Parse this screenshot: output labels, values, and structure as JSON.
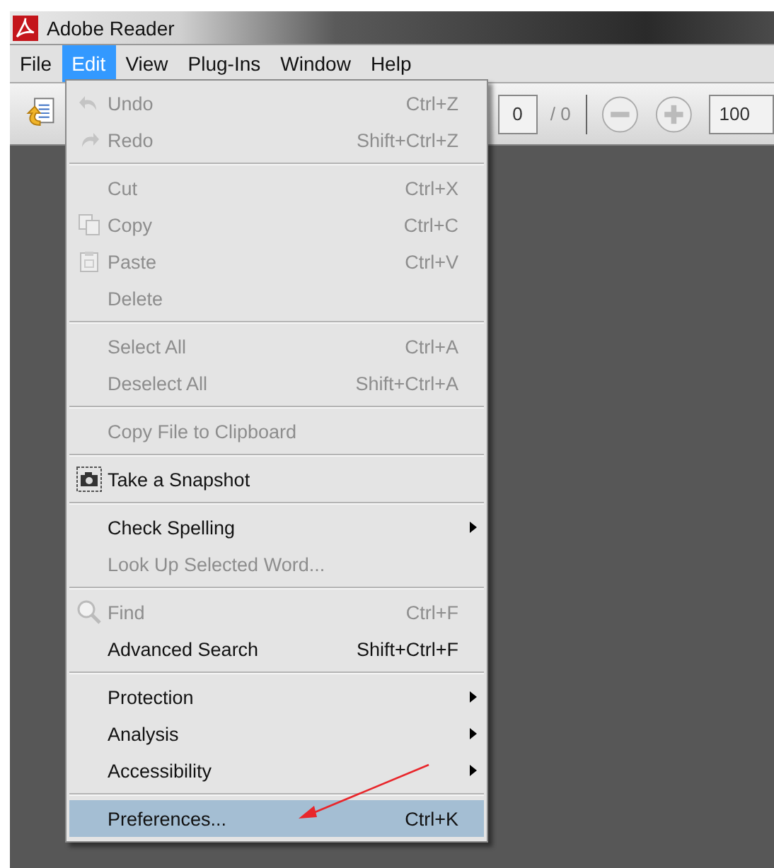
{
  "window": {
    "title": "Adobe Reader"
  },
  "menubar": [
    {
      "label": "File",
      "selected": false
    },
    {
      "label": "Edit",
      "selected": true
    },
    {
      "label": "View",
      "selected": false
    },
    {
      "label": "Plug-Ins",
      "selected": false
    },
    {
      "label": "Window",
      "selected": false
    },
    {
      "label": "Help",
      "selected": false
    }
  ],
  "toolbar": {
    "page_field": "0",
    "page_total": "/ 0",
    "zoom_field": "100"
  },
  "edit_menu": [
    [
      {
        "label": "Undo",
        "shortcut": "Ctrl+Z",
        "disabled": true,
        "kind": "undo",
        "submenu": false,
        "selected": false
      },
      {
        "label": "Redo",
        "shortcut": "Shift+Ctrl+Z",
        "disabled": true,
        "kind": "redo",
        "submenu": false,
        "selected": false
      }
    ],
    [
      {
        "label": "Cut",
        "shortcut": "Ctrl+X",
        "disabled": true,
        "kind": "plain",
        "submenu": false,
        "selected": false
      },
      {
        "label": "Copy",
        "shortcut": "Ctrl+C",
        "disabled": true,
        "kind": "copy",
        "submenu": false,
        "selected": false
      },
      {
        "label": "Paste",
        "shortcut": "Ctrl+V",
        "disabled": true,
        "kind": "paste",
        "submenu": false,
        "selected": false
      },
      {
        "label": "Delete",
        "disabled": true,
        "kind": "plain",
        "submenu": false,
        "selected": false
      }
    ],
    [
      {
        "label": "Select All",
        "shortcut": "Ctrl+A",
        "disabled": true,
        "kind": "plain",
        "submenu": false,
        "selected": false
      },
      {
        "label": "Deselect All",
        "shortcut": "Shift+Ctrl+A",
        "disabled": true,
        "kind": "plain",
        "submenu": false,
        "selected": false
      }
    ],
    [
      {
        "label": "Copy File to Clipboard",
        "disabled": true,
        "kind": "plain",
        "submenu": false,
        "selected": false
      }
    ],
    [
      {
        "label": "Take a Snapshot",
        "disabled": false,
        "kind": "snapshot",
        "submenu": false,
        "selected": false
      }
    ],
    [
      {
        "label": "Check Spelling",
        "disabled": false,
        "kind": "plain",
        "submenu": true,
        "selected": false
      },
      {
        "label": "Look Up Selected Word...",
        "disabled": true,
        "kind": "plain",
        "submenu": false,
        "selected": false
      }
    ],
    [
      {
        "label": "Find",
        "shortcut": "Ctrl+F",
        "disabled": true,
        "kind": "search",
        "submenu": false,
        "selected": false
      },
      {
        "label": "Advanced Search",
        "shortcut": "Shift+Ctrl+F",
        "disabled": false,
        "kind": "plain",
        "submenu": false,
        "selected": false
      }
    ],
    [
      {
        "label": "Protection",
        "disabled": false,
        "kind": "plain",
        "submenu": true,
        "selected": false
      },
      {
        "label": "Analysis",
        "disabled": false,
        "kind": "plain",
        "submenu": true,
        "selected": false
      },
      {
        "label": "Accessibility",
        "disabled": false,
        "kind": "plain",
        "submenu": true,
        "selected": false
      }
    ],
    [
      {
        "label": "Preferences...",
        "shortcut": "Ctrl+K",
        "disabled": false,
        "kind": "plain",
        "submenu": false,
        "selected": true
      }
    ]
  ]
}
